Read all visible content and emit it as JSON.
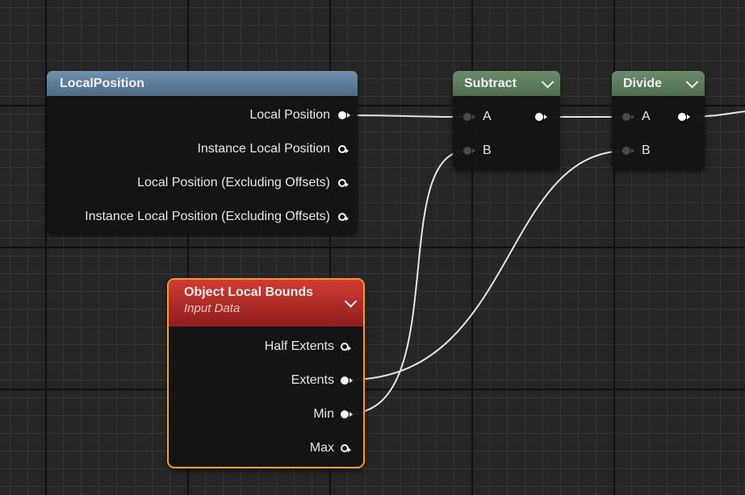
{
  "nodes": {
    "local_position": {
      "title": "LocalPosition",
      "outputs": [
        "Local Position",
        "Instance Local Position",
        "Local Position (Excluding Offsets)",
        "Instance Local Position (Excluding Offsets)"
      ]
    },
    "subtract": {
      "title": "Subtract",
      "inputs": [
        "A",
        "B"
      ]
    },
    "divide": {
      "title": "Divide",
      "inputs": [
        "A",
        "B"
      ]
    },
    "object_local_bounds": {
      "title": "Object Local Bounds",
      "subtitle": "Input Data",
      "outputs": [
        "Half Extents",
        "Extents",
        "Min",
        "Max"
      ]
    }
  },
  "colors": {
    "background": "#262626",
    "local_position_header": "#5e7e9c",
    "math_header": "#5c7a5c",
    "input_data_header": "#c82828",
    "selection_outline": "#f2a01c",
    "wire": "#e6e6e6"
  },
  "icons": {
    "collapse": "chevron-down-icon",
    "pin_connected": "filled-pin-icon",
    "pin_unconnected": "hollow-pin-icon"
  }
}
